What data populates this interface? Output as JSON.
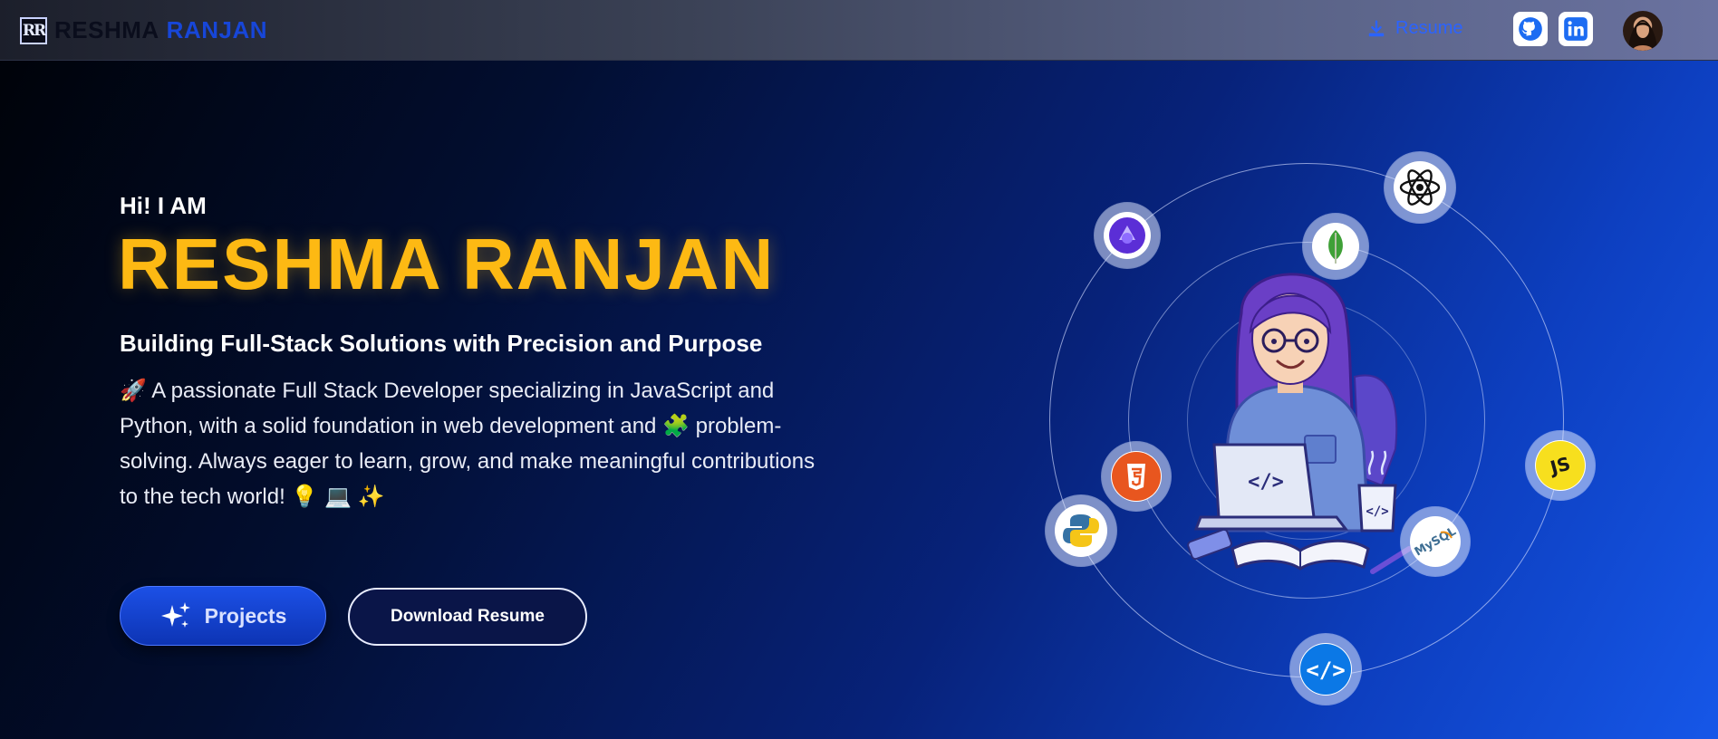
{
  "brand": {
    "first": "RESHMA",
    "last": "RANJAN",
    "mark": "RR"
  },
  "nav": {
    "resume_label": "Resume"
  },
  "social": {
    "github": "github-icon",
    "linkedin": "linkedin-icon"
  },
  "hero": {
    "greeting": "Hi! I AM",
    "name": "RESHMA RANJAN",
    "tagline": "Building Full-Stack Solutions with Precision and Purpose",
    "bio": "🚀 A passionate Full Stack Developer specializing in JavaScript and Python, with a solid foundation in web development and 🧩 problem-solving. Always eager to learn, grow, and make meaningful contributions to the tech world! 💡 💻 ✨"
  },
  "buttons": {
    "projects": "Projects",
    "download": "Download Resume"
  },
  "orbit_icons": [
    "redux-icon",
    "mongodb-icon",
    "react-icon",
    "html5-icon",
    "python-icon",
    "javascript-icon",
    "mysql-icon",
    "code-icon"
  ],
  "colors": {
    "accent": "#fdb913",
    "brand_blue": "#1746d8",
    "link_blue": "#2b63ff"
  }
}
